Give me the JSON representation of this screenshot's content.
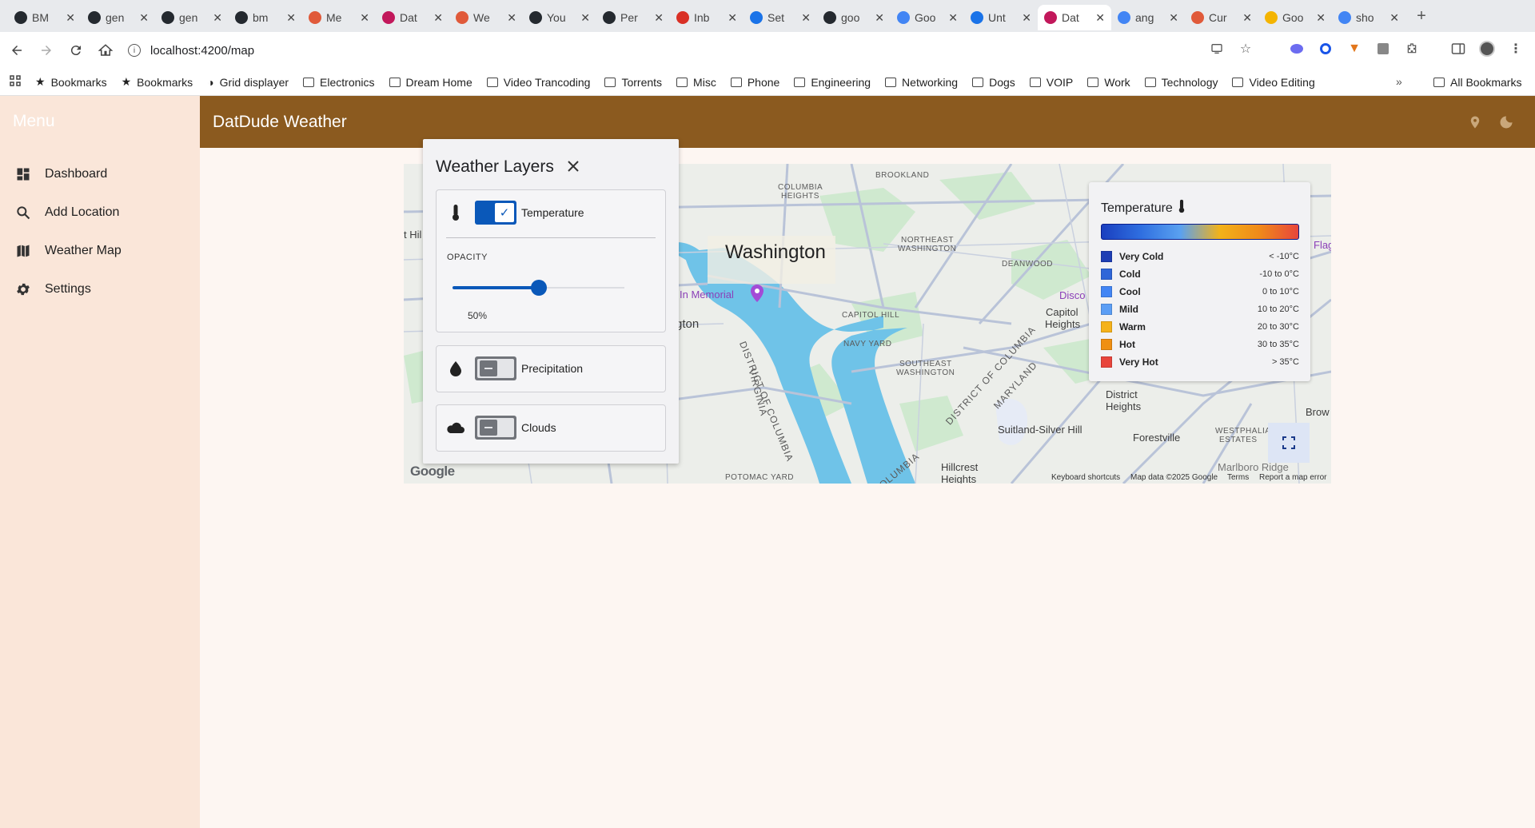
{
  "tabs": [
    {
      "title": "BM",
      "icon": "github-icon",
      "color": "#24292f"
    },
    {
      "title": "gen",
      "icon": "github-icon",
      "color": "#24292f"
    },
    {
      "title": "gen",
      "icon": "github-icon",
      "color": "#24292f"
    },
    {
      "title": "bm",
      "icon": "github-icon",
      "color": "#24292f"
    },
    {
      "title": "Me",
      "icon": "meta-icon",
      "color": "#e05a3a"
    },
    {
      "title": "Dat",
      "icon": "angular-icon",
      "color": "#c2185b"
    },
    {
      "title": "We",
      "icon": "weather-icon",
      "color": "#e05a3a"
    },
    {
      "title": "You",
      "icon": "github-icon",
      "color": "#24292f"
    },
    {
      "title": "Per",
      "icon": "github-icon",
      "color": "#24292f"
    },
    {
      "title": "Inb",
      "icon": "gmail-icon",
      "color": "#d93025"
    },
    {
      "title": "Set",
      "icon": "gear-icon",
      "color": "#1a73e8"
    },
    {
      "title": "goo",
      "icon": "github-icon",
      "color": "#24292f"
    },
    {
      "title": "Goo",
      "icon": "gemini-icon",
      "color": "#4285f4"
    },
    {
      "title": "Unt",
      "icon": "docs-icon",
      "color": "#1a73e8"
    },
    {
      "title": "Dat",
      "icon": "angular-icon",
      "color": "#c2185b",
      "active": true
    },
    {
      "title": "ang",
      "icon": "google-icon",
      "color": "#4285f4"
    },
    {
      "title": "Cur",
      "icon": "cursor-icon",
      "color": "#e05a3a"
    },
    {
      "title": "Goo",
      "icon": "keep-icon",
      "color": "#f4b400"
    },
    {
      "title": "sho",
      "icon": "google-icon",
      "color": "#4285f4"
    }
  ],
  "address": {
    "url": "localhost:4200/map"
  },
  "bookmarks": [
    {
      "label": "Bookmarks",
      "icon": "star-icon"
    },
    {
      "label": "Bookmarks",
      "icon": "star-icon"
    },
    {
      "label": "Grid displayer",
      "icon": "grid-icon"
    },
    {
      "label": "Electronics",
      "icon": "folder-icon"
    },
    {
      "label": "Dream Home",
      "icon": "folder-icon"
    },
    {
      "label": "Video Trancoding",
      "icon": "folder-icon"
    },
    {
      "label": "Torrents",
      "icon": "folder-icon"
    },
    {
      "label": "Misc",
      "icon": "folder-icon"
    },
    {
      "label": "Phone",
      "icon": "folder-icon"
    },
    {
      "label": "Engineering",
      "icon": "folder-icon"
    },
    {
      "label": "Networking",
      "icon": "folder-icon"
    },
    {
      "label": "Dogs",
      "icon": "folder-icon"
    },
    {
      "label": "VOIP",
      "icon": "folder-icon"
    },
    {
      "label": "Work",
      "icon": "folder-icon"
    },
    {
      "label": "Technology",
      "icon": "folder-icon"
    },
    {
      "label": "Video Editing",
      "icon": "folder-icon"
    }
  ],
  "all_bookmarks_label": "All Bookmarks",
  "sidebar": {
    "title": "Menu",
    "items": [
      {
        "label": "Dashboard",
        "icon": "dashboard-icon"
      },
      {
        "label": "Add Location",
        "icon": "search-icon"
      },
      {
        "label": "Weather Map",
        "icon": "map-icon"
      },
      {
        "label": "Settings",
        "icon": "gear-icon"
      }
    ]
  },
  "header": {
    "title": "DatDude Weather"
  },
  "layers_panel": {
    "title": "Weather Layers",
    "temperature": {
      "label": "Temperature",
      "enabled": true
    },
    "opacity": {
      "label": "OPACITY",
      "value_text": "50%",
      "value": 0.5
    },
    "precipitation": {
      "label": "Precipitation",
      "enabled": false
    },
    "clouds": {
      "label": "Clouds",
      "enabled": false
    }
  },
  "legend": {
    "title": "Temperature",
    "gradient_colors": [
      "#1a3fbf",
      "#2f6fe0",
      "#5aa1f0",
      "#f2b21a",
      "#f08a1a",
      "#e8453c"
    ],
    "items": [
      {
        "label": "Very Cold",
        "range": "< -10°C",
        "color": "#1e3eb4"
      },
      {
        "label": "Cold",
        "range": "-10 to 0°C",
        "color": "#2f66d8"
      },
      {
        "label": "Cool",
        "range": "0 to 10°C",
        "color": "#4285f4"
      },
      {
        "label": "Mild",
        "range": "10 to 20°C",
        "color": "#5b9ef5"
      },
      {
        "label": "Warm",
        "range": "20 to 30°C",
        "color": "#f5b21a"
      },
      {
        "label": "Hot",
        "range": "30 to 35°C",
        "color": "#ef8f12"
      },
      {
        "label": "Very Hot",
        "range": "> 35°C",
        "color": "#e8453c"
      }
    ]
  },
  "map": {
    "city": "Washington",
    "labels": [
      {
        "text": "COLUMBIA",
        "size": "small"
      },
      {
        "text": "HEIGHTS",
        "size": "small"
      },
      {
        "text": "BROOKLAND",
        "size": "small"
      },
      {
        "text": "NORTHEAST",
        "size": "small"
      },
      {
        "text": "WASHINGTON",
        "size": "small"
      },
      {
        "text": "DEANWOOD",
        "size": "small"
      },
      {
        "text": "In Memorial",
        "size": "med"
      },
      {
        "text": "gton",
        "size": "med"
      },
      {
        "text": "CAPITOL HILL",
        "size": "small"
      },
      {
        "text": "NAVY YARD",
        "size": "small"
      },
      {
        "text": "SOUTHEAST",
        "size": "small"
      },
      {
        "text": "WASHINGTON",
        "size": "small"
      },
      {
        "text": "Capitol",
        "size": "med"
      },
      {
        "text": "Heights",
        "size": "med"
      },
      {
        "text": "District",
        "size": "med"
      },
      {
        "text": "Heights",
        "size": "med"
      },
      {
        "text": "Suitland-Silver Hill",
        "size": "med"
      },
      {
        "text": "Forestville",
        "size": "med"
      },
      {
        "text": "Hillcrest",
        "size": "med"
      },
      {
        "text": "Heights",
        "size": "med"
      },
      {
        "text": "POTOMAC YARD",
        "size": "small"
      },
      {
        "text": "WESTPHALIA",
        "size": "small"
      },
      {
        "text": "ESTATES",
        "size": "small"
      },
      {
        "text": "Marlboro Ridge",
        "size": "med"
      },
      {
        "text": "Brow",
        "size": "med"
      },
      {
        "text": "t Hil",
        "size": "med"
      },
      {
        "text": "Disco",
        "size": "med"
      },
      {
        "text": "Flag",
        "size": "med"
      }
    ],
    "rotated_labels": [
      "DISTRICT OF COLUMBIA",
      "VIRGINIA",
      "DISTRICT OF COLUMBIA",
      "MARYLAND",
      "OLUMBIA"
    ],
    "google_logo": "Google",
    "attribution": {
      "shortcuts": "Keyboard shortcuts",
      "data": "Map data ©2025 Google",
      "terms": "Terms",
      "report": "Report a map error"
    }
  }
}
